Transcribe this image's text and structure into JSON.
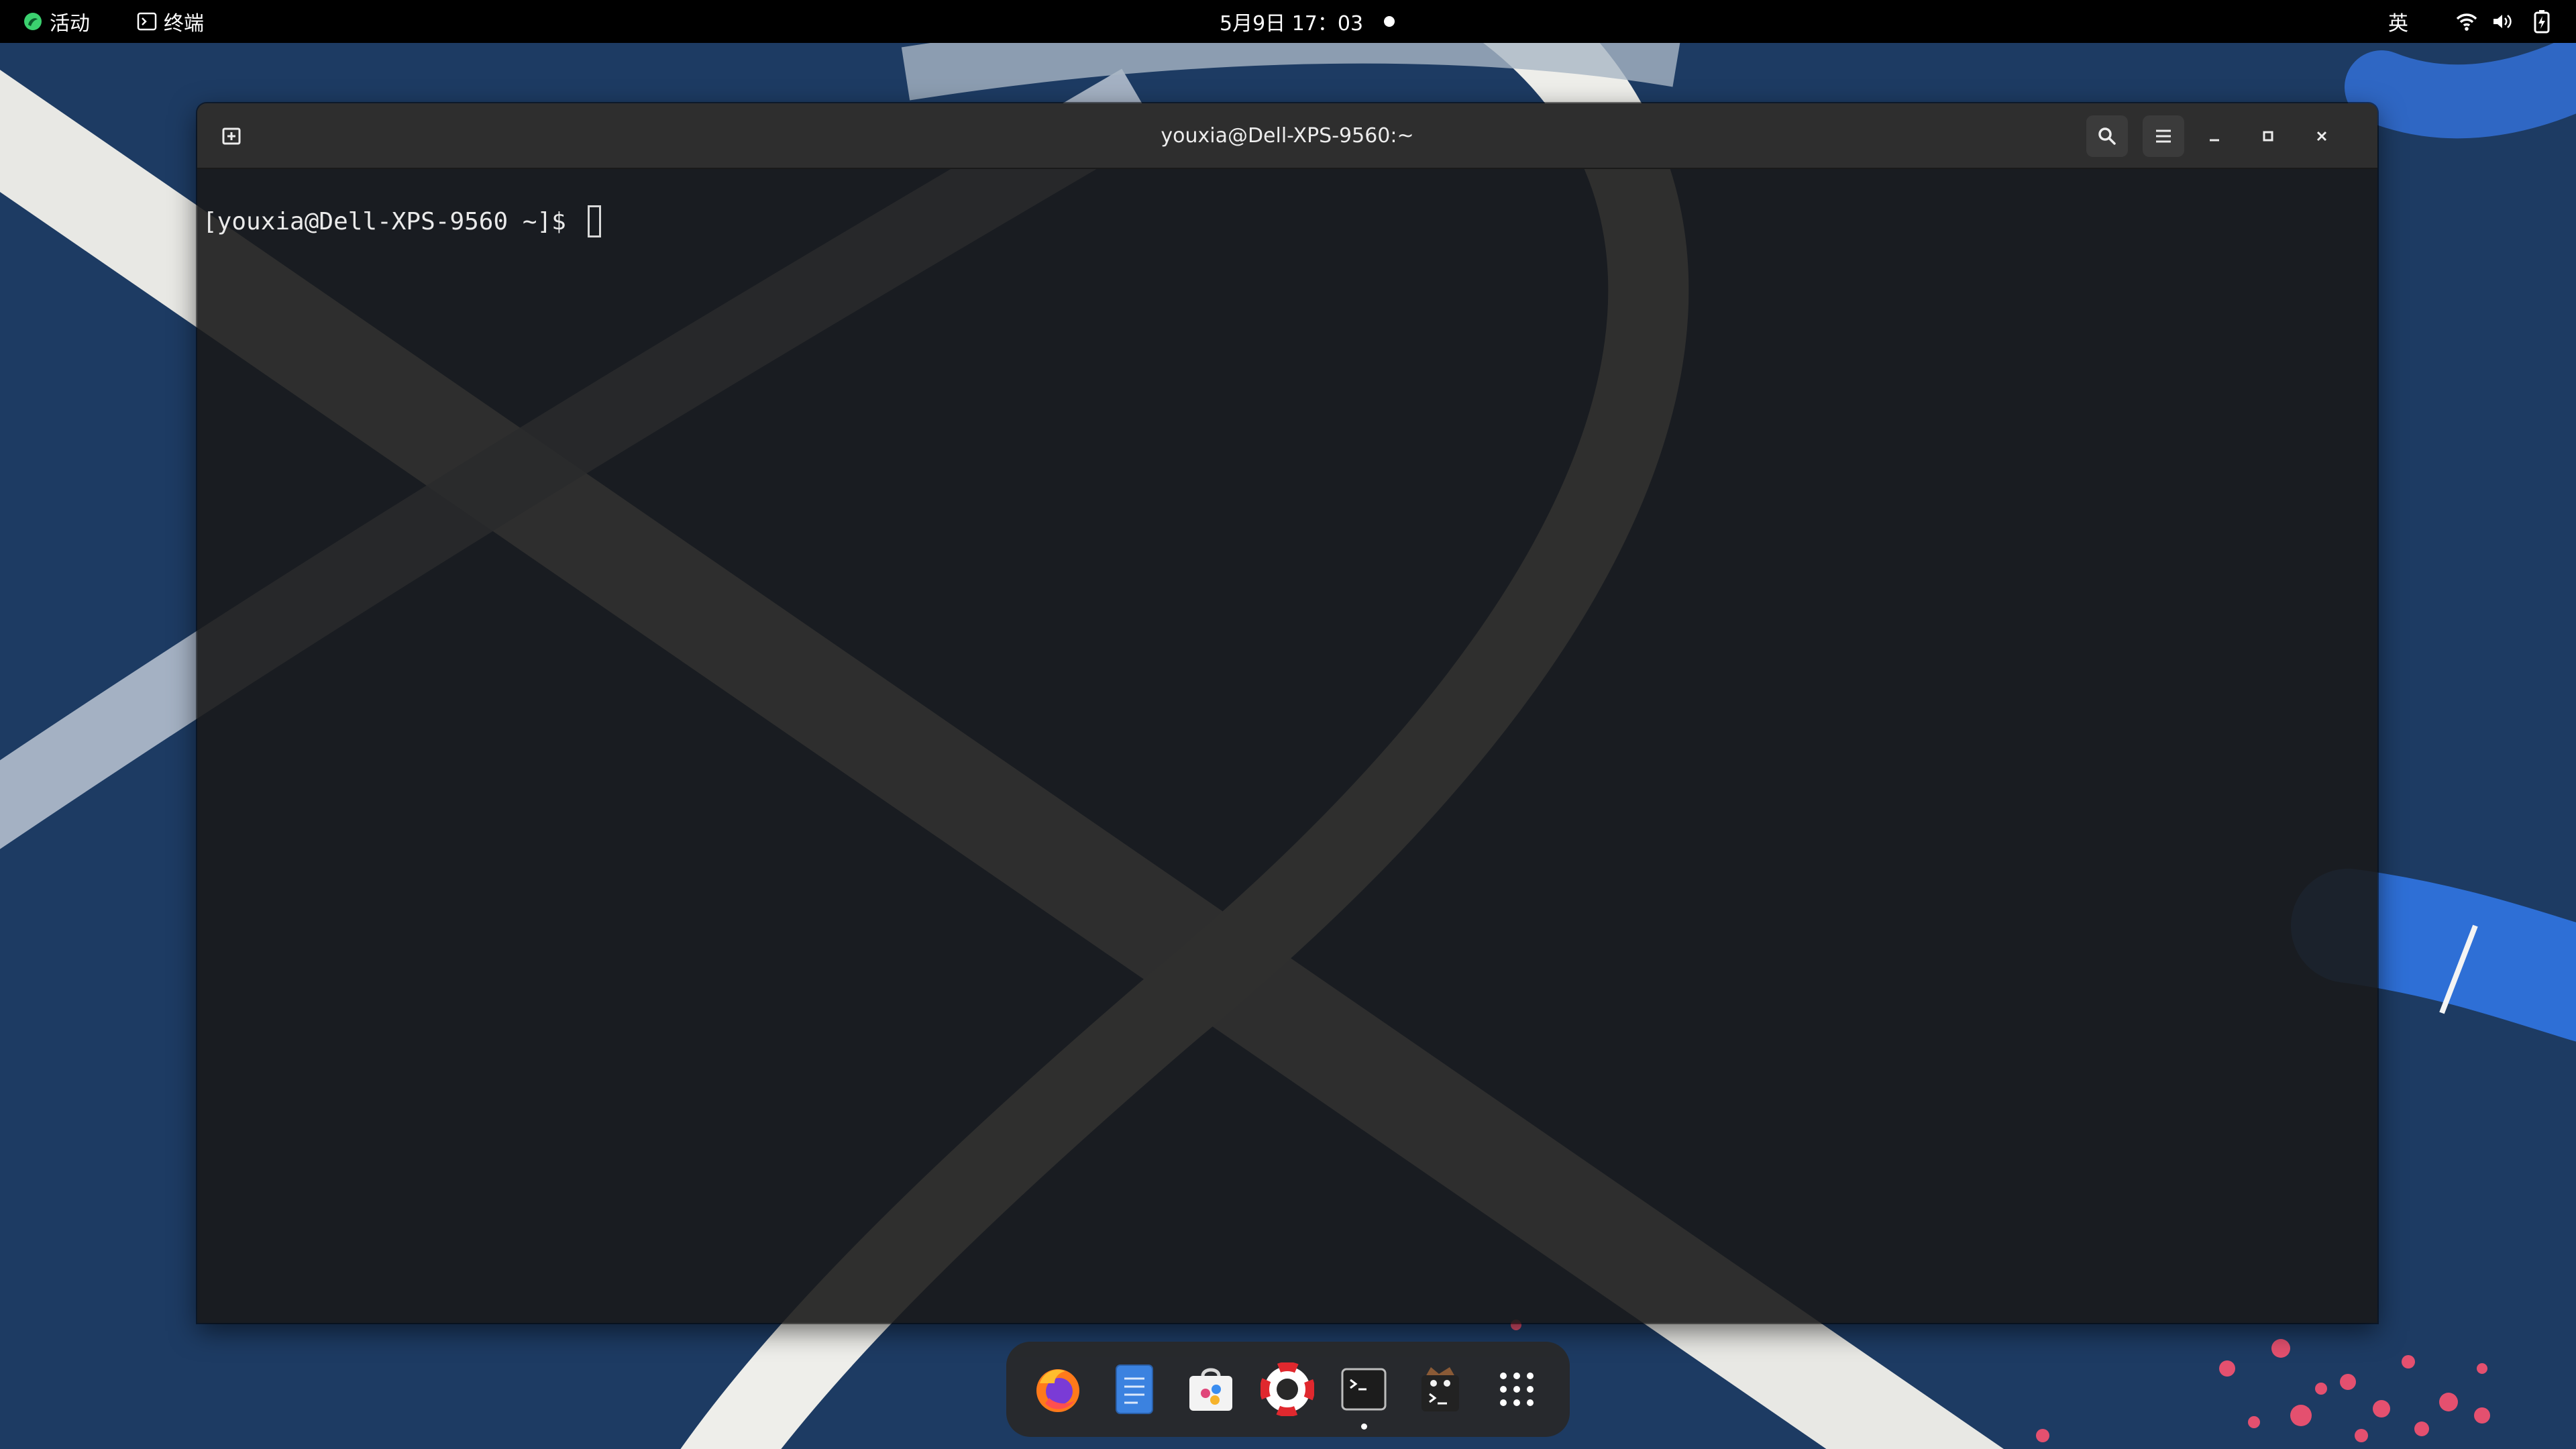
{
  "topbar": {
    "activities_label": "活动",
    "app_menu_label": "终端",
    "clock": "5月9日  17：03",
    "input_method": "英",
    "icons": [
      "activities-logo-icon",
      "terminal-app-icon",
      "notification-dot",
      "wifi-icon",
      "volume-icon",
      "battery-icon"
    ]
  },
  "window": {
    "title": "youxia@Dell-XPS-9560:~",
    "buttons": [
      "new-tab-icon",
      "search-icon",
      "hamburger-menu-icon",
      "minimize-icon",
      "maximize-icon",
      "close-icon"
    ]
  },
  "terminal": {
    "prompt": "[youxia@Dell-XPS-9560 ~]$ "
  },
  "dock": {
    "items": [
      "firefox-icon",
      "text-editor-icon",
      "software-center-icon",
      "help-lifebuoy-icon",
      "terminal-icon",
      "terminal-alt-icon",
      "app-grid-icon"
    ],
    "running_app": "terminal-icon"
  },
  "colors": {
    "topbar_bg": "#000000",
    "desktop_bg": "#1d3b63",
    "headerbar_bg": "#2e2e2e",
    "terminal_bg": "#1a1a1a",
    "text": "#ececec",
    "accent_green": "#3bd16f"
  }
}
